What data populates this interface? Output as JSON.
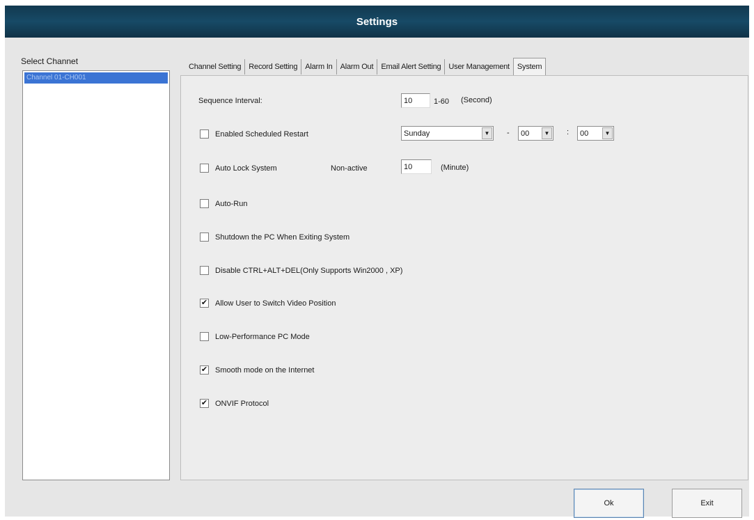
{
  "window": {
    "title": "Settings"
  },
  "channel_panel": {
    "label": "Select Channet",
    "items": [
      "Channel 01-CH001"
    ]
  },
  "tabs": [
    "Channel Setting",
    "Record Setting",
    "Alarm In",
    "Alarm Out",
    "Email Alert Setting",
    "User Management",
    "System"
  ],
  "active_tab": "System",
  "system": {
    "sequence_interval": {
      "label": "Sequence Interval:",
      "value": "10",
      "range": "1-60",
      "unit": "(Second)"
    },
    "scheduled_restart": {
      "label": "Enabled Scheduled Restart",
      "checked": false,
      "day": "Sunday",
      "dash": "-",
      "hour": "00",
      "colon": ":",
      "minute": "00"
    },
    "auto_lock": {
      "label": "Auto Lock System",
      "checked": false,
      "nonactive_label": "Non-active",
      "value": "10",
      "unit": "(Minute)"
    },
    "options": [
      {
        "label": "Auto-Run",
        "checked": false
      },
      {
        "label": "Shutdown the PC When Exiting System",
        "checked": false
      },
      {
        "label": "Disable CTRL+ALT+DEL(Only Supports Win2000 , XP)",
        "checked": false
      },
      {
        "label": "Allow User to Switch Video Position",
        "checked": true
      },
      {
        "label": "Low-Performance PC Mode",
        "checked": false
      },
      {
        "label": "Smooth mode on the Internet",
        "checked": true
      },
      {
        "label": "ONVIF Protocol",
        "checked": true
      }
    ]
  },
  "buttons": {
    "ok": "Ok",
    "exit": "Exit"
  },
  "icons": {
    "checkmark": "✔",
    "dropdown": "▼"
  }
}
